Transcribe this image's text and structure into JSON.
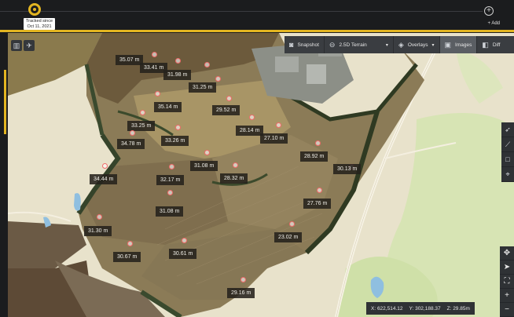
{
  "timeline": {
    "tracked_text": "Tracked since Oct 11, 2021",
    "add_label": "+ Add",
    "add_icon": "plus-circle-icon"
  },
  "map_controls": {
    "map_icon": "map-icon",
    "satellite_icon": "satellite-icon"
  },
  "toolbar": {
    "snapshot": "Snapshot",
    "terrain": "2.5D Terrain",
    "overlays": "Overlays",
    "images": "Images",
    "diff": "Diff"
  },
  "right_tools": [
    "cursor-icon",
    "measure-line-icon",
    "area-square-icon",
    "pin-icon"
  ],
  "nav_tools": [
    "compass-icon",
    "pointer-icon",
    "fullscreen-icon",
    "zoom-in-icon",
    "zoom-out-icon"
  ],
  "coords": {
    "x": "X: 622,514.12",
    "y": "Y: 302,188.37",
    "z": "Z: 29.85m"
  },
  "measurements": [
    {
      "label": "35.07 m"
    },
    {
      "label": "33.41 m"
    },
    {
      "label": "31.98 m"
    },
    {
      "label": "31.25 m"
    },
    {
      "label": "35.14 m"
    },
    {
      "label": "29.52 m"
    },
    {
      "label": "33.25 m"
    },
    {
      "label": "28.14 m"
    },
    {
      "label": "27.10 m"
    },
    {
      "label": "34.78 m"
    },
    {
      "label": "33.26 m"
    },
    {
      "label": "28.92 m"
    },
    {
      "label": "31.08 m"
    },
    {
      "label": "30.13 m"
    },
    {
      "label": "34.44 m"
    },
    {
      "label": "32.17 m"
    },
    {
      "label": "28.32 m"
    },
    {
      "label": "31.08 m"
    },
    {
      "label": "27.76 m"
    },
    {
      "label": "31.30 m"
    },
    {
      "label": "23.02 m"
    },
    {
      "label": "30.67 m"
    },
    {
      "label": "30.61 m"
    },
    {
      "label": "29.16 m"
    }
  ],
  "colors": {
    "accent": "#e3b521",
    "point": "#f06a6a"
  }
}
